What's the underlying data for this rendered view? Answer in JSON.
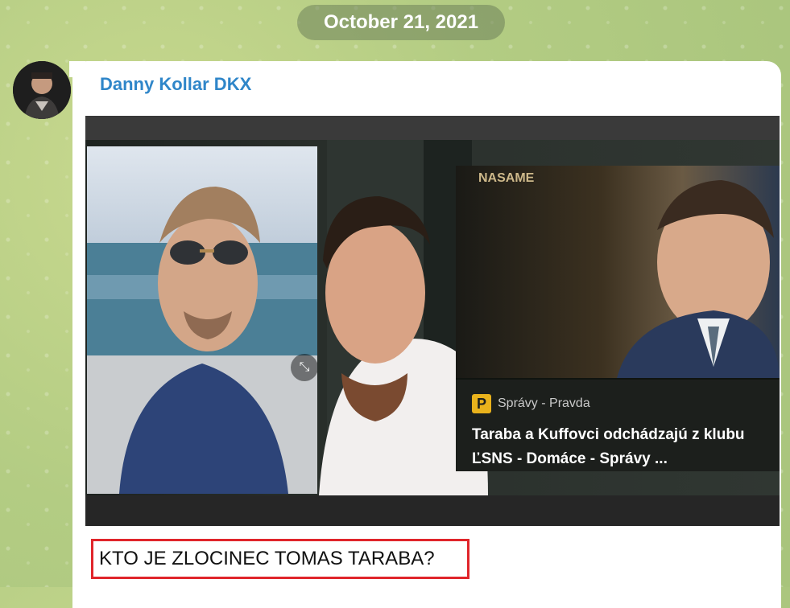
{
  "date_divider": "October 21, 2021",
  "message": {
    "sender_name": "Danny Kollar DKX",
    "caption": "KTO JE ZLOCINEC TOMAS TARABA?",
    "media": {
      "news_card": {
        "source": "Správy - Pravda",
        "source_logo_letter": "P",
        "headline": "Taraba a Kuffovci odchádzajú z klubu ĽSNS - Domáce - Správy ..."
      },
      "shrink_icon": "collapse-arrows-icon"
    }
  },
  "colors": {
    "sender_name": "#2f86c9",
    "caption_highlight_border": "#e0252b",
    "bubble_background": "#ffffff",
    "chat_background": "#b3cc83"
  }
}
